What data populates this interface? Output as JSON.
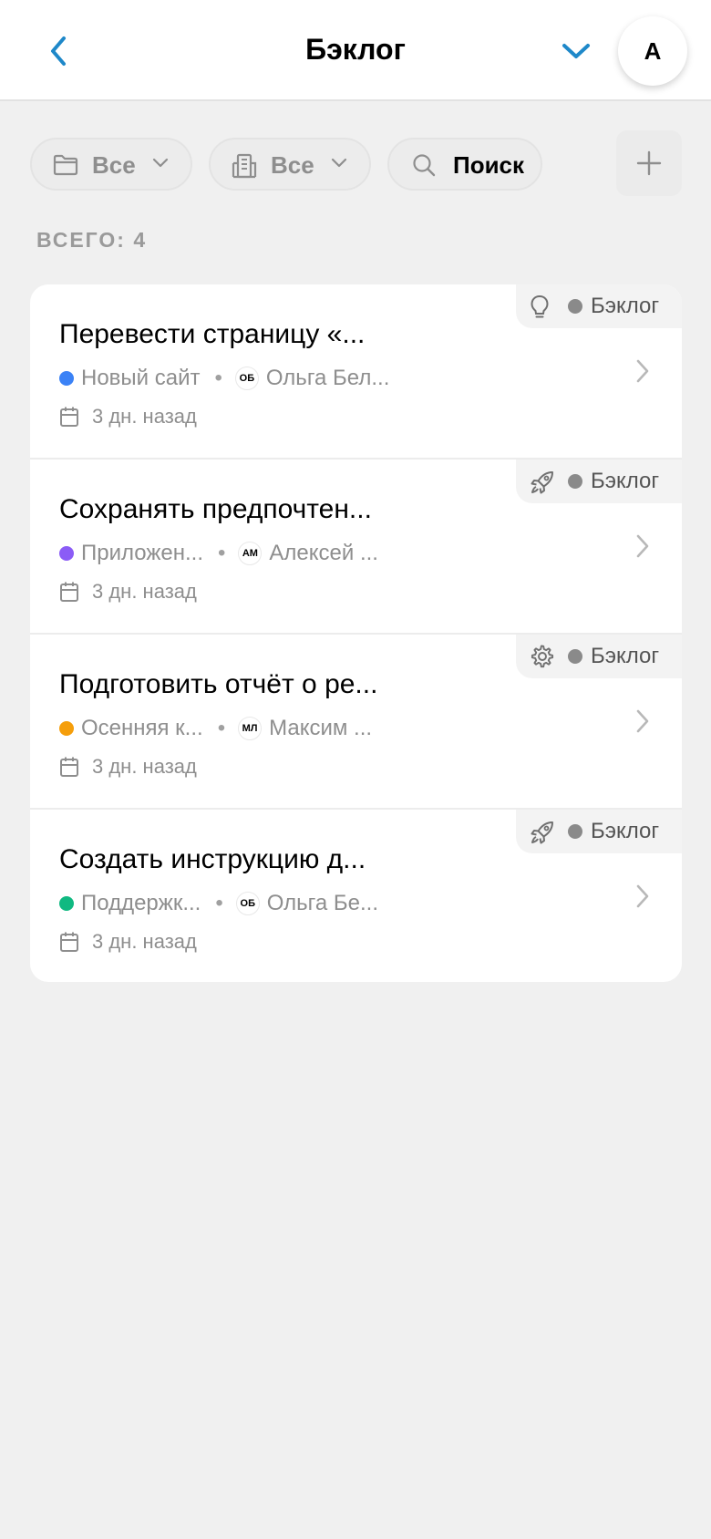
{
  "header": {
    "title": "Бэклог",
    "avatar_letter": "A"
  },
  "filters": {
    "folder_label": "Все",
    "organization_label": "Все",
    "search_label": "Поиск"
  },
  "total_label": "ВСЕГО: 4",
  "colors": {
    "accent": "#1e88c9",
    "status_dot": "#8a8a8a"
  },
  "items": [
    {
      "title": "Перевести страницу «...",
      "status_icon": "lightbulb-icon",
      "status": "Бэклог",
      "project": "Новый сайт",
      "project_color": "#3b82f6",
      "assignee_initials": "ОБ",
      "assignee": "Ольга Бел...",
      "date": "3 дн. назад"
    },
    {
      "title": "Сохранять предпочтен...",
      "status_icon": "rocket-icon",
      "status": "Бэклог",
      "project": "Приложен...",
      "project_color": "#8b5cf6",
      "assignee_initials": "АМ",
      "assignee": "Алексей ...",
      "date": "3 дн. назад"
    },
    {
      "title": "Подготовить отчёт о ре...",
      "status_icon": "gear-icon",
      "status": "Бэклог",
      "project": "Осенняя к...",
      "project_color": "#f59e0b",
      "assignee_initials": "МЛ",
      "assignee": "Максим ...",
      "date": "3 дн. назад"
    },
    {
      "title": "Создать инструкцию д...",
      "status_icon": "rocket-icon",
      "status": "Бэклог",
      "project": "Поддержк...",
      "project_color": "#10b981",
      "assignee_initials": "ОБ",
      "assignee": "Ольга Бе...",
      "date": "3 дн. назад"
    }
  ]
}
